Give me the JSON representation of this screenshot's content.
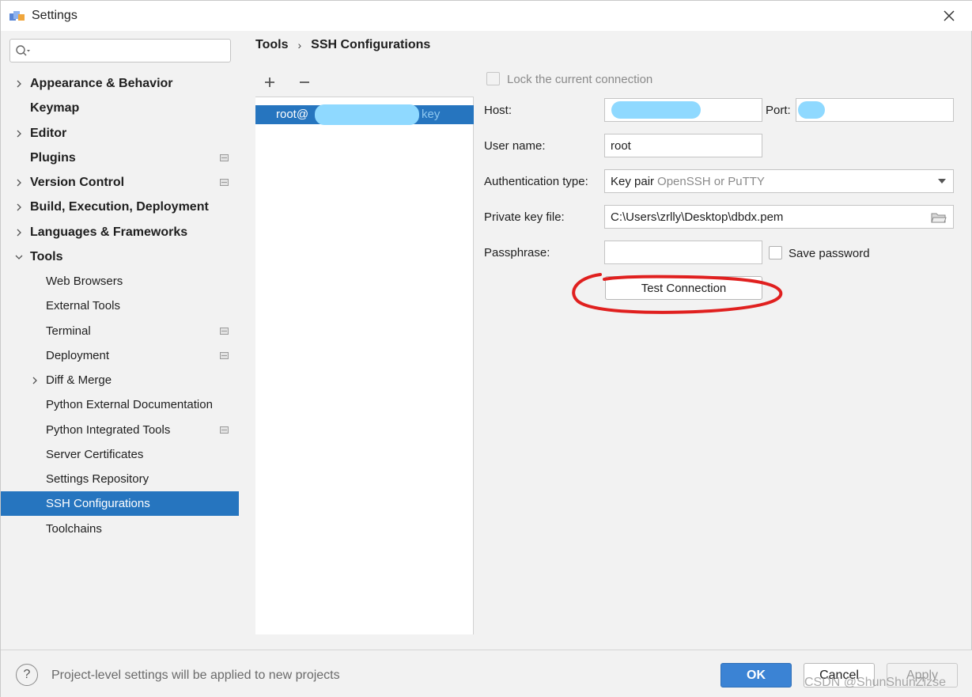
{
  "window": {
    "title": "Settings"
  },
  "sidebar": {
    "search_placeholder": "",
    "items": [
      {
        "label": "Appearance & Behavior",
        "icon": "chevron-right"
      },
      {
        "label": "Keymap"
      },
      {
        "label": "Editor",
        "icon": "chevron-right"
      },
      {
        "label": "Plugins",
        "project_icon": true
      },
      {
        "label": "Version Control",
        "icon": "chevron-right",
        "project_icon": true
      },
      {
        "label": "Build, Execution, Deployment",
        "icon": "chevron-right"
      },
      {
        "label": "Languages & Frameworks",
        "icon": "chevron-right"
      },
      {
        "label": "Tools",
        "icon": "chevron-down"
      },
      {
        "label": "Web Browsers"
      },
      {
        "label": "External Tools"
      },
      {
        "label": "Terminal",
        "project_icon": true
      },
      {
        "label": "Deployment",
        "project_icon": true
      },
      {
        "label": "Diff & Merge",
        "icon": "chevron-right"
      },
      {
        "label": "Python External Documentation"
      },
      {
        "label": "Python Integrated Tools",
        "project_icon": true
      },
      {
        "label": "Server Certificates"
      },
      {
        "label": "Settings Repository"
      },
      {
        "label": "SSH Configurations",
        "selected": true
      },
      {
        "label": "Toolchains"
      }
    ]
  },
  "breadcrumb": {
    "parent": "Tools",
    "current": "SSH Configurations"
  },
  "ssh_list": {
    "add_icon": "plus-icon",
    "remove_icon": "minus-icon",
    "entry_prefix": "root@",
    "entry_suffix": "key"
  },
  "form": {
    "lock_label": "Lock the current connection",
    "host_label": "Host:",
    "host_value": "",
    "port_label": "Port:",
    "port_value": "",
    "username_label": "User name:",
    "username_value": "root",
    "auth_label": "Authentication type:",
    "auth_value": "Key pair",
    "auth_value_hint": "OpenSSH or PuTTY",
    "keyfile_label": "Private key file:",
    "keyfile_value": "C:\\Users\\zrlly\\Desktop\\dbdx.pem",
    "passphrase_label": "Passphrase:",
    "passphrase_value": "",
    "save_password_label": "Save password",
    "test_button": "Test Connection"
  },
  "footer": {
    "info": "Project-level settings will be applied to new projects",
    "help": "?",
    "ok": "OK",
    "cancel": "Cancel",
    "apply": "Apply"
  },
  "watermark": "CSDN @ShunShunZizse",
  "colors": {
    "selection": "#2675bf",
    "ok_button": "#3b83d4",
    "annotation": "#e0201f",
    "redaction": "#8fd9ff"
  }
}
